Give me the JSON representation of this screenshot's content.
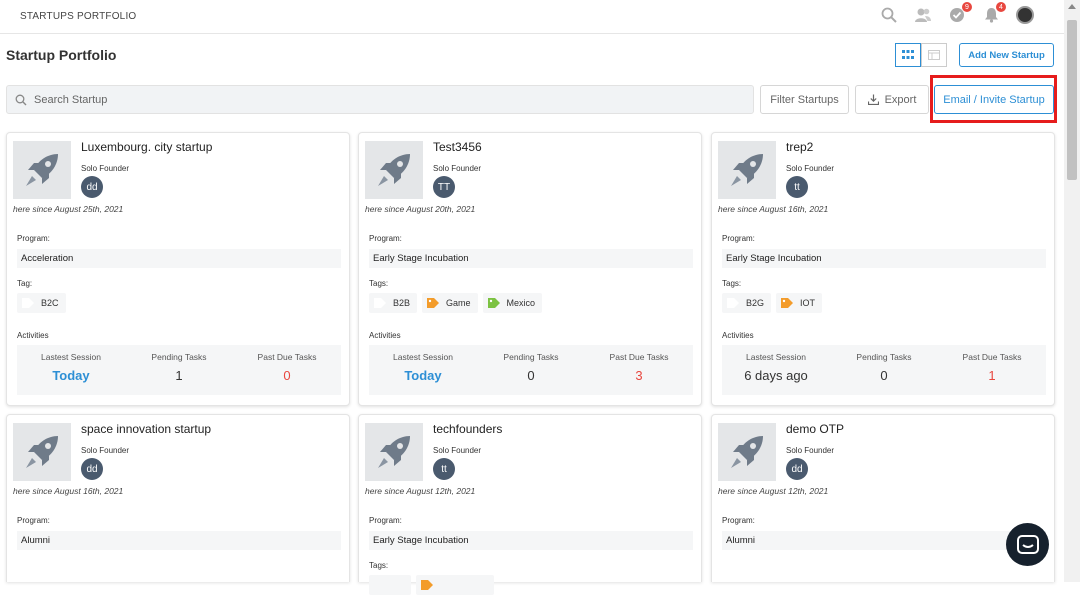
{
  "header": {
    "brand": "STARTUPS PORTFOLIO",
    "tasks_badge": "9",
    "notifications_badge": "4"
  },
  "page": {
    "title": "Startup Portfolio",
    "add_button": "Add New Startup",
    "search_placeholder": "Search Startup",
    "filter_button": "Filter Startups",
    "export_button": "Export",
    "invite_button": "Email / Invite Startup"
  },
  "labels": {
    "program": "Program:",
    "activities": "Activities",
    "latest_session": "Lastest Session",
    "pending_tasks": "Pending Tasks",
    "past_due_tasks": "Past Due Tasks"
  },
  "cards": [
    {
      "name": "Luxembourg. city startup",
      "role": "Solo Founder",
      "initials": "dd",
      "since": "here since August 25th, 2021",
      "program": "Acceleration",
      "tag_label": "Tag:",
      "tags": [
        {
          "text": "B2C",
          "icon": "blank-tag-icon",
          "color": "#ffffff"
        }
      ],
      "latest_session": "Today",
      "pending_tasks": "1",
      "past_due": "0"
    },
    {
      "name": "Test3456",
      "role": "Solo Founder",
      "initials": "TT",
      "since": "here since August 20th, 2021",
      "program": "Early Stage Incubation",
      "tag_label": "Tags:",
      "tags": [
        {
          "text": "B2B",
          "icon": "blank-tag-icon",
          "color": "#ffffff"
        },
        {
          "text": "Game",
          "icon": "tag-icon",
          "color": "#f39c2b"
        },
        {
          "text": "Mexico",
          "icon": "tag-icon",
          "color": "#7cc242"
        }
      ],
      "latest_session": "Today",
      "pending_tasks": "0",
      "past_due": "3"
    },
    {
      "name": "trep2",
      "role": "Solo Founder",
      "initials": "tt",
      "since": "here since August 16th, 2021",
      "program": "Early Stage Incubation",
      "tag_label": "Tags:",
      "tags": [
        {
          "text": "B2G",
          "icon": "blank-tag-icon",
          "color": "#ffffff"
        },
        {
          "text": "IOT",
          "icon": "tag-icon",
          "color": "#f39c2b"
        }
      ],
      "latest_session": "6 days ago",
      "pending_tasks": "0",
      "past_due": "1"
    },
    {
      "name": "space innovation startup",
      "role": "Solo Founder",
      "initials": "dd",
      "since": "here since August 16th, 2021",
      "program": "Alumni"
    },
    {
      "name": "techfounders",
      "role": "Solo Founder",
      "initials": "tt",
      "since": "here since August 12th, 2021",
      "program": "Early Stage Incubation",
      "tag_label": "Tags:"
    },
    {
      "name": "demo OTP",
      "role": "Solo Founder",
      "initials": "dd",
      "since": "here since August 12th, 2021",
      "program": "Alumni"
    }
  ],
  "colors": {
    "accent": "#2d8fd5",
    "danger": "#e8473f",
    "highlight": "#e61c1c"
  }
}
